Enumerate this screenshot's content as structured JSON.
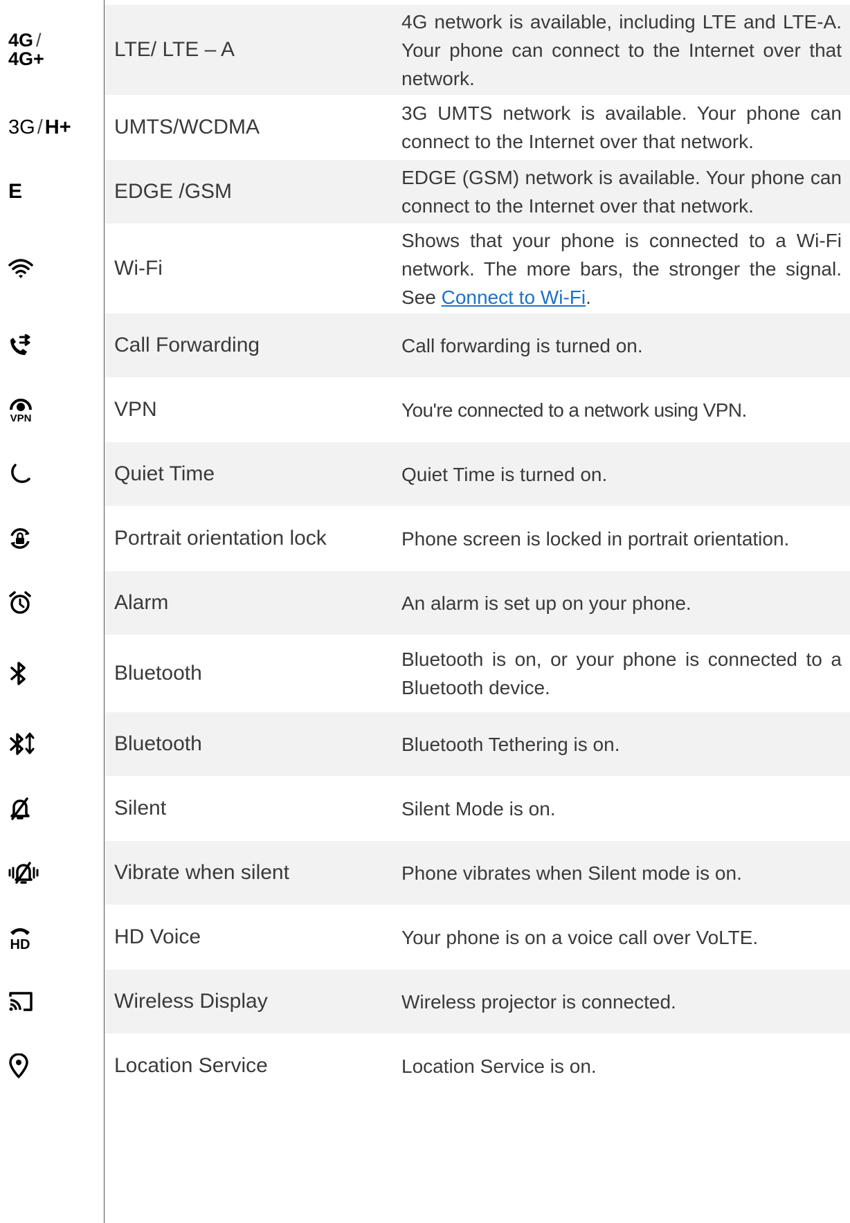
{
  "rows": [
    {
      "icon": "4g-lte-icon",
      "icon_text_top": "4G",
      "icon_slash": "/",
      "icon_text_bottom": "4G+",
      "name": "LTE/ LTE – A",
      "desc": "4G network is available, including LTE and LTE-A. Your phone can connect to the Internet over that network."
    },
    {
      "icon": "3g-hplus-icon",
      "icon_text_a": "3G",
      "icon_slash": "/",
      "icon_text_b": "H+",
      "name": "UMTS/WCDMA",
      "desc": "3G UMTS network is available. Your phone can connect to the Internet over that network."
    },
    {
      "icon": "edge-icon",
      "icon_text": "E",
      "name": "EDGE /GSM",
      "desc": "EDGE (GSM) network is available. Your phone can connect to the Internet over that network."
    },
    {
      "icon": "wifi-icon",
      "name": "Wi-Fi",
      "desc_prefix": "Shows that your phone is connected to a Wi-Fi network. The more bars, the stronger the signal. See ",
      "desc_link": "Connect to Wi-Fi",
      "desc_suffix": "."
    },
    {
      "icon": "call-forwarding-icon",
      "name": "Call Forwarding",
      "desc": "Call forwarding is turned on."
    },
    {
      "icon": "vpn-icon",
      "name": "VPN",
      "desc": "You're connected to a network using VPN."
    },
    {
      "icon": "quiet-time-moon-icon",
      "name": "Quiet Time",
      "desc": "Quiet Time is turned on."
    },
    {
      "icon": "portrait-lock-icon",
      "name": "Portrait orientation lock",
      "desc": "Phone screen is locked in portrait orientation."
    },
    {
      "icon": "alarm-clock-icon",
      "name": "Alarm",
      "desc": "An alarm is set up on your phone."
    },
    {
      "icon": "bluetooth-icon",
      "name": "Bluetooth",
      "desc": "Bluetooth is on, or your phone is connected to a Bluetooth device."
    },
    {
      "icon": "bluetooth-tethering-icon",
      "name": "Bluetooth",
      "desc": "Bluetooth Tethering is on."
    },
    {
      "icon": "silent-bell-icon",
      "name": "Silent",
      "desc": "Silent Mode is on."
    },
    {
      "icon": "vibrate-silent-icon",
      "name": "Vibrate when silent",
      "desc": "Phone vibrates when Silent mode is on."
    },
    {
      "icon": "hd-voice-icon",
      "icon_text": "HD",
      "name": "HD Voice",
      "desc": "Your phone is on a voice call over VoLTE."
    },
    {
      "icon": "wireless-display-cast-icon",
      "name": "Wireless Display",
      "desc": "Wireless projector is connected."
    },
    {
      "icon": "location-pin-icon",
      "name": "Location Service",
      "desc": "Location Service is on."
    }
  ]
}
